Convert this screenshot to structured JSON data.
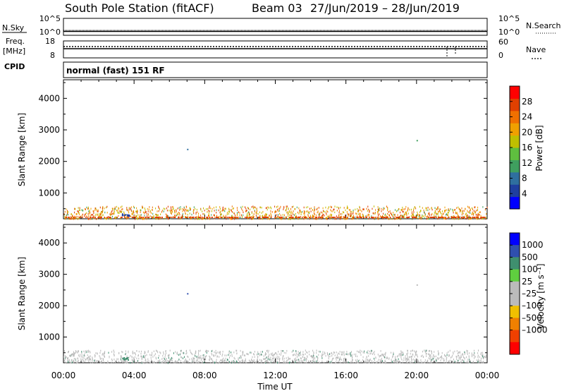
{
  "header": {
    "station": "South Pole Station (fitACF)",
    "beam": "Beam 03",
    "date_range": "27/Jun/2019 – 28/Jun/2019",
    "mode": "normal (fast) 151 RF"
  },
  "side_labels": {
    "nsky": "N.Sky",
    "freq_top": "Freq.",
    "freq_unit": "[MHz]",
    "cpid": "CPID",
    "nsearch": "N.Search",
    "nave": "Nave"
  },
  "small_axes": {
    "noise_left_top": "10^5",
    "noise_left_bottom": "10^0",
    "noise_right_top": "10^5",
    "noise_right_bottom": "10^0",
    "freq_left_top": "18",
    "freq_left_bottom": "8",
    "nave_right_top": "60",
    "nave_right_bottom": "0"
  },
  "colors": {
    "power": [
      "#0000ff",
      "#1f3f9f",
      "#2f6f9f",
      "#3f9f5f",
      "#5fbf3f",
      "#bfbf00",
      "#f0a000",
      "#f07000",
      "#e04000",
      "#ff0000"
    ],
    "velocity": [
      "#0000ff",
      "#2f4faf",
      "#3f8f6f",
      "#5fcf3f",
      "#bbbbbb",
      "#bbbbbb",
      "#f0c000",
      "#f08000",
      "#f04000",
      "#ff0000"
    ]
  },
  "chart_data": {
    "type": "heatmap",
    "xlabel": "Time UT",
    "x_ticks": [
      "00:00",
      "04:00",
      "08:00",
      "12:00",
      "16:00",
      "20:00",
      "00:00"
    ],
    "xlim_hours": [
      0,
      24
    ],
    "panels": [
      {
        "name": "power",
        "ylabel": "Slant Range [km]",
        "ylim": [
          180,
          4590
        ],
        "y_ticks": [
          1000,
          2000,
          3000,
          4000
        ],
        "colorbar_label": "Power [dB]",
        "colorbar_ticks": [
          "4",
          "8",
          "12",
          "16",
          "20",
          "24",
          "28"
        ],
        "colorbar_range": [
          0,
          32
        ]
      },
      {
        "name": "velocity",
        "ylabel": "Slant Range [km]",
        "ylim": [
          180,
          4590
        ],
        "y_ticks": [
          1000,
          2000,
          3000,
          4000
        ],
        "colorbar_label": "Velocity [m s⁻¹]",
        "colorbar_ticks": [
          "1000",
          "500",
          "100",
          "25",
          "–25",
          "–100",
          "–500",
          "–1000"
        ]
      }
    ],
    "scatter_band_km": [
      200,
      600
    ],
    "isolated_echoes": [
      {
        "time_h": 7.0,
        "range_km": 2400
      },
      {
        "time_h": 20.0,
        "range_km": 2680
      }
    ]
  }
}
